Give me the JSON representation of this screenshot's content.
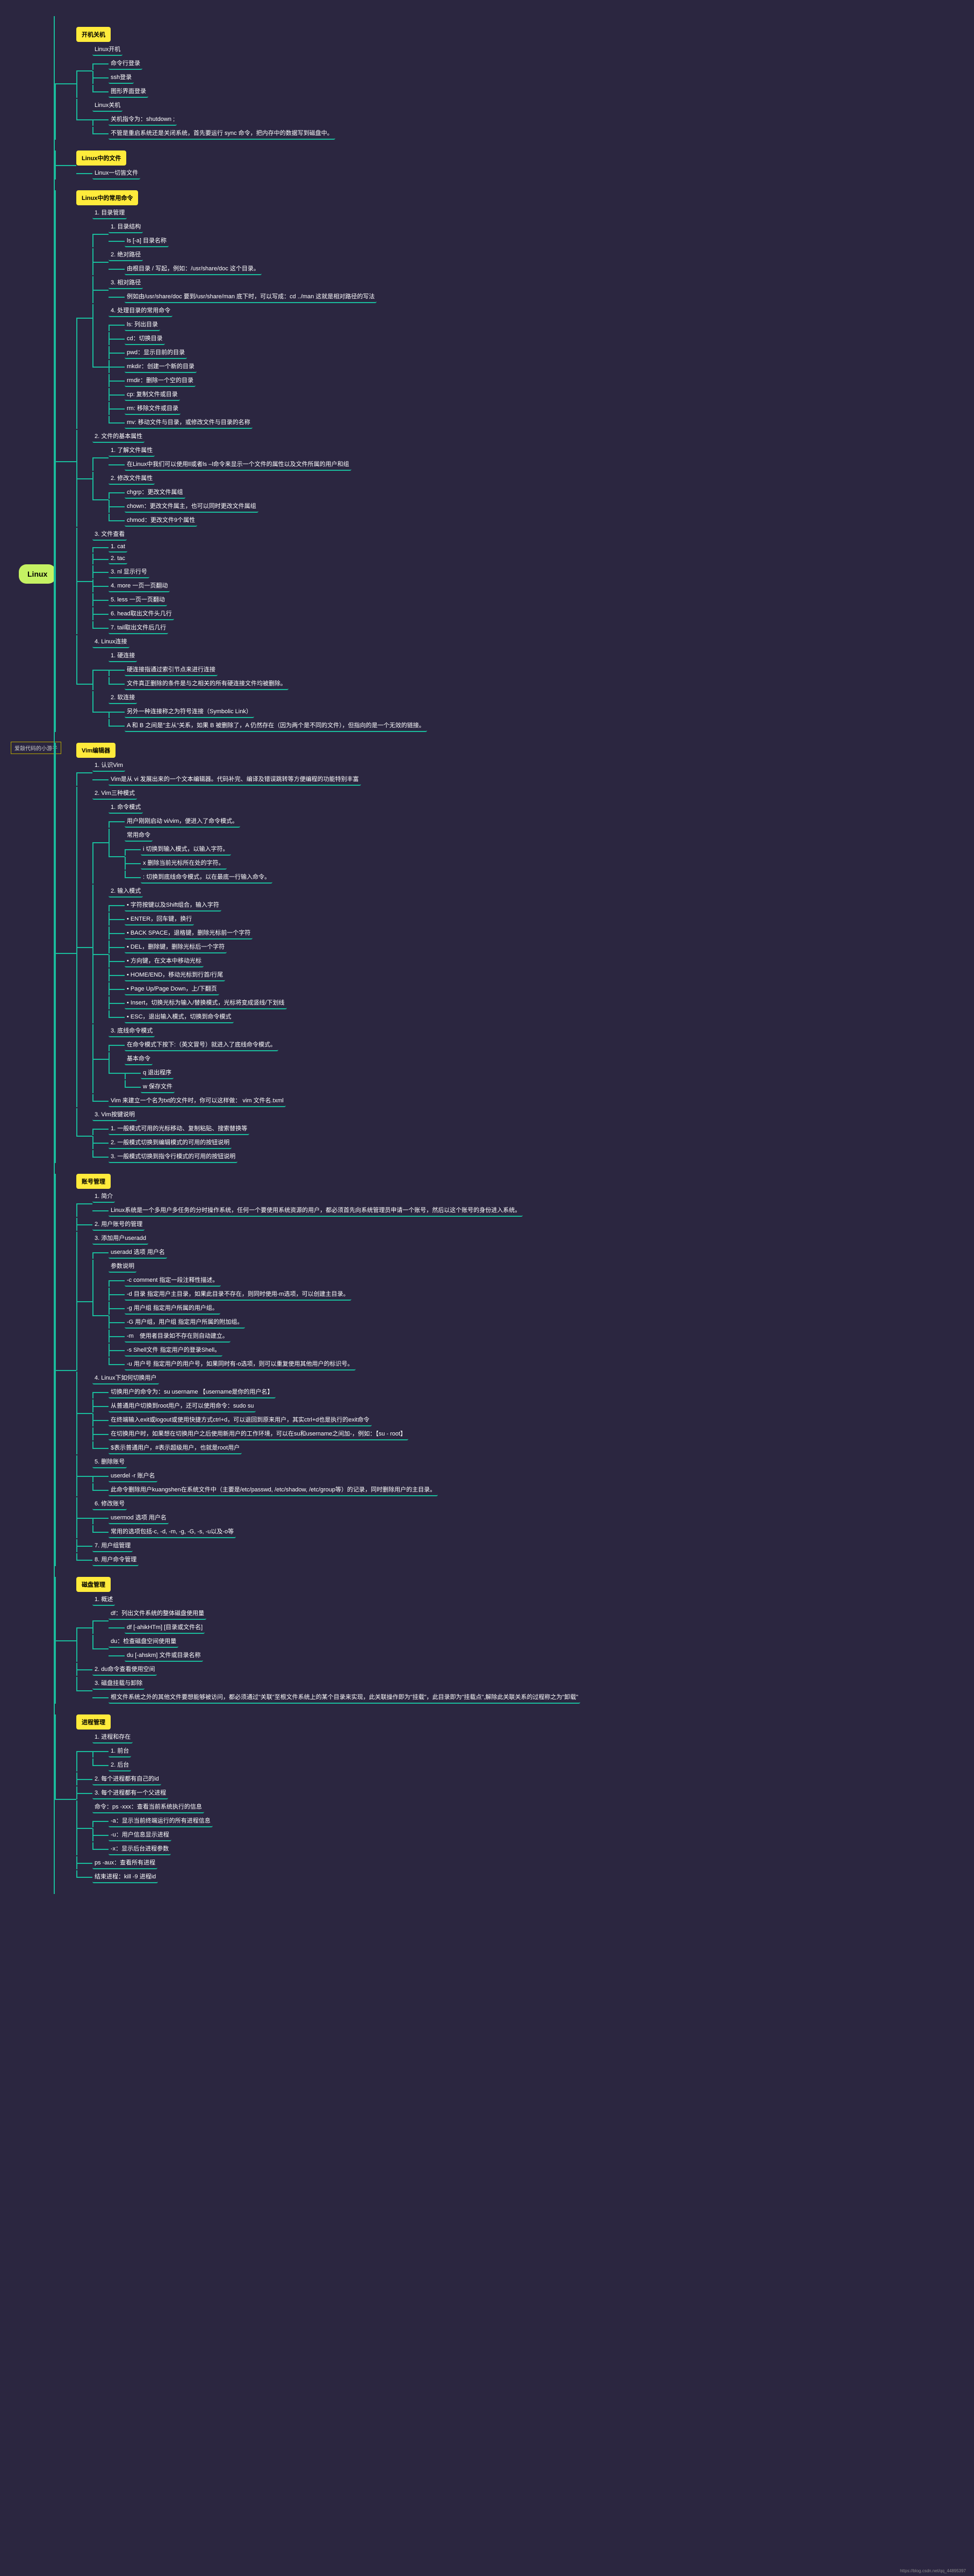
{
  "root": "Linux",
  "watermark": "爱敲代码的小游子",
  "source": "https://blog.csdn.net/qq_44895397",
  "chart_data": {
    "type": "mindmap",
    "root": "Linux",
    "children": [
      {
        "label": "开机关机",
        "children": [
          {
            "label": "Linux开机",
            "children": [
              {
                "label": "命令行登录"
              },
              {
                "label": "ssh登录"
              },
              {
                "label": "图形界面登录"
              }
            ]
          },
          {
            "label": "Linux关机",
            "children": [
              {
                "label": "关机指令为：shutdown ;"
              },
              {
                "label": "不管是重启系统还是关闭系统，首先要运行 sync 命令，把内存中的数据写到磁盘中。"
              }
            ]
          }
        ]
      },
      {
        "label": "Linux中的文件",
        "children": [
          {
            "label": "Linux一切皆文件"
          }
        ]
      },
      {
        "label": "Linux中的常用命令",
        "children": [
          {
            "label": "1. 目录管理",
            "children": [
              {
                "label": "1. 目录结构",
                "note": "ls [-a] 目录名称"
              },
              {
                "label": "2. 绝对路径",
                "note": "由根目录 / 写起，例如：/usr/share/doc 这个目录。"
              },
              {
                "label": "3. 相对路径",
                "note": "例如由/usr/share/doc 要到/usr/share/man 底下时，可以写成：cd ../man 这就是相对路径的写法"
              },
              {
                "label": "4. 处理目录的常用命令",
                "children": [
                  {
                    "label": "ls: 列出目录"
                  },
                  {
                    "label": "cd：切换目录"
                  },
                  {
                    "label": "pwd：显示目前的目录"
                  },
                  {
                    "label": "mkdir：创建一个新的目录"
                  },
                  {
                    "label": "rmdir：删除一个空的目录"
                  },
                  {
                    "label": "cp: 复制文件或目录"
                  },
                  {
                    "label": "rm: 移除文件或目录"
                  },
                  {
                    "label": "mv: 移动文件与目录，或修改文件与目录的名称"
                  }
                ]
              }
            ]
          },
          {
            "label": "2. 文件的基本属性",
            "children": [
              {
                "label": "1. 了解文件属性",
                "note": "在Linux中我们可以使用ll或者ls –l命令来显示一个文件的属性以及文件所属的用户和组"
              },
              {
                "label": "2. 修改文件属性",
                "children": [
                  {
                    "label": "chgrp：更改文件属组"
                  },
                  {
                    "label": "chown：更改文件属主，也可以同时更改文件属组"
                  },
                  {
                    "label": "chmod：更改文件9个属性"
                  }
                ]
              }
            ]
          },
          {
            "label": "3. 文件查看",
            "children": [
              {
                "label": "1. cat"
              },
              {
                "label": "2. tac"
              },
              {
                "label": "3. nl 显示行号"
              },
              {
                "label": "4. more 一页一页翻动"
              },
              {
                "label": "5. less 一页一页翻动"
              },
              {
                "label": "6. head取出文件头几行"
              },
              {
                "label": "7. tail取出文件后几行"
              }
            ]
          },
          {
            "label": "4. Linux连接",
            "children": [
              {
                "label": "1. 硬连接",
                "children": [
                  {
                    "label": "硬连接指通过索引节点来进行连接"
                  },
                  {
                    "label": "文件真正删除的条件是与之相关的所有硬连接文件均被删除。"
                  }
                ]
              },
              {
                "label": "2. 软连接",
                "children": [
                  {
                    "label": "另外一种连接称之为符号连接（Symbolic Link）"
                  },
                  {
                    "label": "A 和 B 之间是\"主从\"关系，如果 B 被删除了，A 仍然存在（因为两个是不同的文件），但指向的是一个无效的链接。"
                  }
                ]
              }
            ]
          }
        ]
      },
      {
        "label": "Vim编辑器",
        "children": [
          {
            "label": "1. 认识Vim",
            "note": "Vim是从 vi 发展出来的一个文本编辑器。代码补完、编译及错误跳转等方便编程的功能特别丰富"
          },
          {
            "label": "2. Vim三种模式",
            "children": [
              {
                "label": "1. 命令模式",
                "children": [
                  {
                    "label": "用户刚刚启动 vi/vim，便进入了命令模式。"
                  },
                  {
                    "label": "常用命令",
                    "children": [
                      {
                        "label": "i 切换到输入模式，以输入字符。"
                      },
                      {
                        "label": "x 删除当前光标所在处的字符。"
                      },
                      {
                        "label": ": 切换到底线命令模式，以在最底一行输入命令。"
                      }
                    ]
                  }
                ]
              },
              {
                "label": "2. 输入模式",
                "children": [
                  {
                    "label": "• 字符按键以及Shift组合，输入字符"
                  },
                  {
                    "label": "• ENTER，回车键，换行"
                  },
                  {
                    "label": "• BACK SPACE，退格键，删除光标前一个字符"
                  },
                  {
                    "label": "• DEL，删除键，删除光标后一个字符"
                  },
                  {
                    "label": "• 方向键，在文本中移动光标"
                  },
                  {
                    "label": "• HOME/END，移动光标到行首/行尾"
                  },
                  {
                    "label": "• Page Up/Page Down，上/下翻页"
                  },
                  {
                    "label": "• Insert，切换光标为输入/替换模式，光标将变成竖线/下划线"
                  },
                  {
                    "label": "• ESC，退出输入模式，切换到命令模式"
                  }
                ]
              },
              {
                "label": "3. 底线命令模式",
                "children": [
                  {
                    "label": "在命令模式下按下:（英文冒号）就进入了底线命令模式。"
                  },
                  {
                    "label": "基本命令",
                    "children": [
                      {
                        "label": "q 退出程序"
                      },
                      {
                        "label": "w 保存文件"
                      }
                    ]
                  }
                ]
              },
              {
                "label": "Vim 来建立一个名为txt的文件时，你可以这样做：  vim 文件名.txml"
              }
            ]
          },
          {
            "label": "3. Vim按键说明",
            "children": [
              {
                "label": "1. 一般模式可用的光标移动、复制粘贴、搜索替换等"
              },
              {
                "label": "2. 一般模式切换到编辑模式的可用的按钮说明"
              },
              {
                "label": "3. 一般模式切换到指令行模式的可用的按钮说明"
              }
            ]
          }
        ]
      },
      {
        "label": "账号管理",
        "children": [
          {
            "label": "1. 简介",
            "note": "Linux系统是一个多用户多任务的分时操作系统，任何一个要使用系统资源的用户，都必须首先向系统管理员申请一个账号，然后以这个账号的身份进入系统。"
          },
          {
            "label": "2. 用户账号的管理"
          },
          {
            "label": "3. 添加用户useradd",
            "children": [
              {
                "label": "useradd 选项 用户名"
              },
              {
                "label": "参数说明",
                "children": [
                  {
                    "label": "-c comment 指定一段注释性描述。"
                  },
                  {
                    "label": "-d 目录 指定用户主目录，如果此目录不存在，则同时使用-m选项，可以创建主目录。"
                  },
                  {
                    "label": "-g 用户组 指定用户所属的用户组。"
                  },
                  {
                    "label": "-G 用户组，用户组 指定用户所属的附加组。"
                  },
                  {
                    "label": "-m　使用者目录如不存在则自动建立。"
                  },
                  {
                    "label": "-s Shell文件 指定用户的登录Shell。"
                  },
                  {
                    "label": "-u 用户号 指定用户的用户号，如果同时有-o选项，则可以重复使用其他用户的标识号。"
                  }
                ]
              }
            ]
          },
          {
            "label": "4. Linux下如何切换用户",
            "children": [
              {
                "label": "切换用户的命令为：su username 【username是你的用户名】"
              },
              {
                "label": "从普通用户切换到root用户，还可以使用命令：sudo su"
              },
              {
                "label": "在终端输入exit或logout或使用快捷方式ctrl+d，可以退回到原来用户，其实ctrl+d也是执行的exit命令"
              },
              {
                "label": "在切换用户时，如果想在切换用户之后使用新用户的工作环境，可以在su和username之间加-，例如：【su - root】"
              },
              {
                "label": "$表示普通用户，#表示超级用户，也就是root用户"
              }
            ]
          },
          {
            "label": "5. 删除账号",
            "children": [
              {
                "label": "userdel -r 账户名"
              },
              {
                "label": "此命令删除用户kuangshen在系统文件中（主要是/etc/passwd, /etc/shadow, /etc/group等）的记录，同时删除用户的主目录。"
              }
            ]
          },
          {
            "label": "6. 修改账号",
            "children": [
              {
                "label": "usermod 选项 用户名"
              },
              {
                "label": "常用的选项包括-c, -d, -m, -g, -G, -s, -u以及-o等"
              }
            ]
          },
          {
            "label": "7. 用户组管理"
          },
          {
            "label": "8. 用户命令管理"
          }
        ]
      },
      {
        "label": "磁盘管理",
        "children": [
          {
            "label": "1. 概述",
            "children": [
              {
                "label": "df：列出文件系统的整体磁盘使用量",
                "note": "df [-ahikHTm] [目录或文件名]"
              },
              {
                "label": "du：检查磁盘空间使用量",
                "note": "du [-ahskm] 文件或目录名称"
              }
            ]
          },
          {
            "label": "2. du命令查看使用空间"
          },
          {
            "label": "3. 磁盘挂载与卸除",
            "note": "根文件系统之外的其他文件要想能够被访问，都必须通过\"关联\"至根文件系统上的某个目录来实现，此关联操作即为\"挂载\"，此目录即为\"挂载点\",解除此关联关系的过程称之为\"卸载\""
          }
        ]
      },
      {
        "label": "进程管理",
        "children": [
          {
            "label": "1. 进程和存在",
            "children": [
              {
                "label": "1. 前台"
              },
              {
                "label": "2. 后台"
              }
            ]
          },
          {
            "label": "2. 每个进程都有自己的id"
          },
          {
            "label": "3. 每个进程都有一个父进程"
          },
          {
            "label": "命令：ps -xxx：查看当前系统执行的信息",
            "children": [
              {
                "label": "-a：显示当前终端运行的所有进程信息"
              },
              {
                "label": "-u：用户信息显示进程"
              },
              {
                "label": "-x：显示后台进程参数"
              }
            ]
          },
          {
            "label": "ps -aux：查看所有进程"
          },
          {
            "label": "结束进程：kill -9 进程id"
          }
        ]
      }
    ]
  }
}
